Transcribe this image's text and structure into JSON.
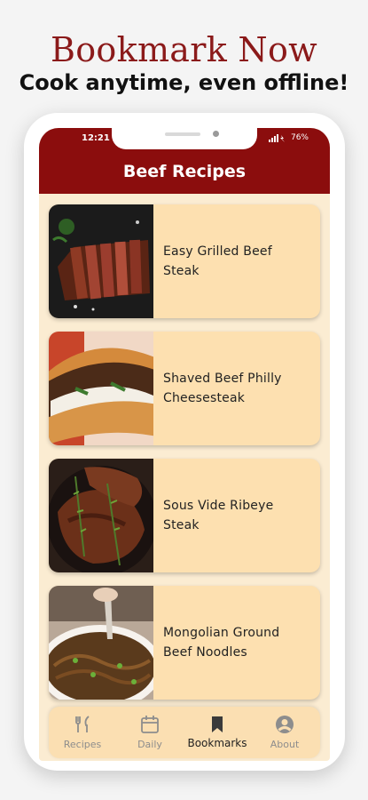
{
  "promo": {
    "title": "Bookmark Now",
    "subtitle": "Cook anytime, even offline!"
  },
  "status_bar": {
    "time": "12:21",
    "battery": "76%"
  },
  "app_bar": {
    "title": "Beef Recipes"
  },
  "recipes": [
    {
      "title": "Easy Grilled Beef Steak",
      "image": "grilled-steak-photo"
    },
    {
      "title": "Shaved Beef Philly Cheesesteak",
      "image": "philly-cheesesteak-photo"
    },
    {
      "title": "Sous Vide Ribeye Steak",
      "image": "ribeye-steak-photo"
    },
    {
      "title": "Mongolian Ground Beef Noodles",
      "image": "beef-noodles-photo"
    }
  ],
  "bottom_nav": [
    {
      "label": "Recipes",
      "icon": "fork-knife-icon",
      "active": false
    },
    {
      "label": "Daily",
      "icon": "calendar-icon",
      "active": false
    },
    {
      "label": "Bookmarks",
      "icon": "bookmark-icon",
      "active": true
    },
    {
      "label": "About",
      "icon": "account-icon",
      "active": false
    }
  ],
  "colors": {
    "brand": "#8b0d0d",
    "promo_title": "#8b1a1a",
    "screen_bg": "#fbecd2",
    "card_bg": "#fde0b0"
  }
}
